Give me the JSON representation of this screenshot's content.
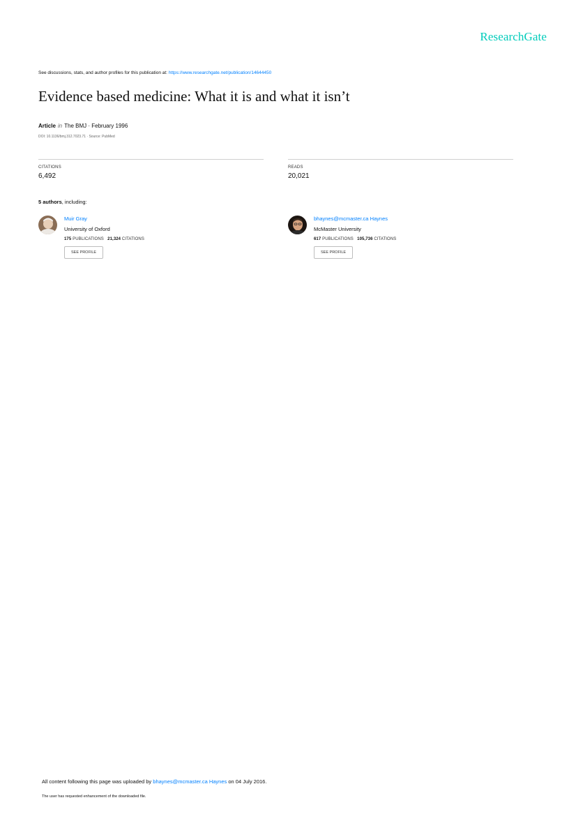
{
  "header": {
    "logo": "ResearchGate"
  },
  "intro": {
    "text": "See discussions, stats, and author profiles for this publication at:",
    "link": "https://www.researchgate.net/publication/14644450"
  },
  "article": {
    "title": "Evidence based medicine: What it is and what it isn’t",
    "type": "Article",
    "in": "in",
    "journal_date": "The BMJ · February 1996",
    "doi_source": "DOI: 10.1136/bmj.312.7023.71 · Source: PubMed"
  },
  "stats": {
    "citations": {
      "label": "CITATIONS",
      "value": "6,492"
    },
    "reads": {
      "label": "READS",
      "value": "20,021"
    }
  },
  "authors_heading": {
    "count": "5 authors",
    "suffix": ", including:"
  },
  "authors": [
    {
      "name": "Muir Gray",
      "institution": "University of Oxford",
      "publications_count": "175",
      "publications_label": "PUBLICATIONS",
      "citations_count": "21,324",
      "citations_label": "CITATIONS",
      "button": "SEE PROFILE"
    },
    {
      "name": "bhaynes@mcmaster.ca Haynes",
      "institution": "McMaster University",
      "publications_count": "617",
      "publications_label": "PUBLICATIONS",
      "citations_count": "105,736",
      "citations_label": "CITATIONS",
      "button": "SEE PROFILE"
    }
  ],
  "footer": {
    "upload_prefix": "All content following this page was uploaded by",
    "uploader": "bhaynes@mcmaster.ca Haynes",
    "upload_suffix": "on 04 July 2016.",
    "note": "The user has requested enhancement of the downloaded file."
  },
  "colors": {
    "brand": "#00ccbb",
    "link": "#0080ff",
    "rule": "#cfcfcf"
  }
}
